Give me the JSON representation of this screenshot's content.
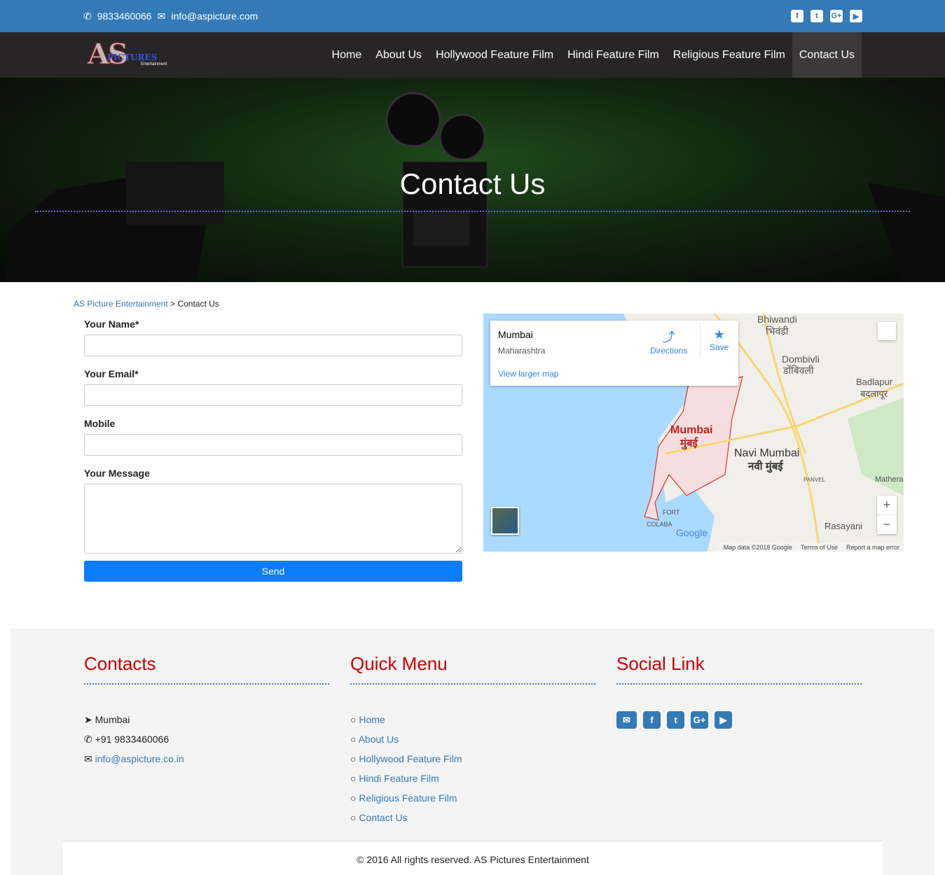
{
  "topbar": {
    "phone": "9833460066",
    "email": "info@aspicture.com",
    "social_icons": [
      "facebook-icon",
      "twitter-icon",
      "google-plus-icon",
      "youtube-icon"
    ]
  },
  "logo": {
    "text": "AS PICTURES Entertainment"
  },
  "nav": {
    "items": [
      "Home",
      "About Us",
      "Hollywood Feature Film",
      "Hindi Feature Film",
      "Religious Feature Film",
      "Contact Us"
    ],
    "active": "Contact Us"
  },
  "hero": {
    "title": "Contact Us"
  },
  "breadcrumb": {
    "home": "AS Picture Entertainment",
    "separator": ">",
    "current": "Contact Us"
  },
  "form": {
    "name_label": "Your Name*",
    "email_label": "Your Email*",
    "mobile_label": "Mobile",
    "message_label": "Your Message",
    "send_label": "Send"
  },
  "map": {
    "place": "Mumbai",
    "region": "Maharashtra",
    "directions": "Directions",
    "save": "Save",
    "larger": "View larger map",
    "labels": {
      "bhiwandi": "Bhiwandi",
      "bhiwandi_hi": "भिवंडी",
      "dombivli": "Dombivli",
      "dombivli_hi": "डोंबिवली",
      "badlapur": "Badlapur",
      "badlapur_hi": "बदलापूर",
      "mumbai": "Mumbai",
      "mumbai_hi": "मुंबई",
      "navi": "Navi Mumbai",
      "navi_hi": "नवी मुंबई",
      "panvel": "PANVEL",
      "rasayani": "Rasayani",
      "matheran": "Mathera",
      "fort": "FORT",
      "colaba": "COLABA"
    },
    "attribution": "Map data ©2018 Google",
    "terms": "Terms of Use",
    "report": "Report a map error",
    "google": "Google",
    "zoom_in": "+",
    "zoom_out": "−",
    "accent": "#4285f4"
  },
  "footer": {
    "contacts": {
      "title": "Contacts",
      "location": "Mumbai",
      "phone": "+91 9833460066",
      "email": "info@aspicture.co.in"
    },
    "quick": {
      "title": "Quick Menu",
      "items": [
        "Home",
        "About Us",
        "Hollywood Feature Film",
        "Hindi Feature Film",
        "Religious Feature Film",
        "Contact Us"
      ]
    },
    "social": {
      "title": "Social Link",
      "icons": [
        "envelope-icon",
        "facebook-icon",
        "twitter-icon",
        "google-plus-icon",
        "youtube-icon"
      ]
    },
    "copyright": "© 2016 All rights reserved. AS Pictures Entertainment"
  },
  "colors": {
    "topbar": "#337ab7",
    "nav": "#272526",
    "heading": "#cc0000",
    "button": "#0a7cff"
  }
}
